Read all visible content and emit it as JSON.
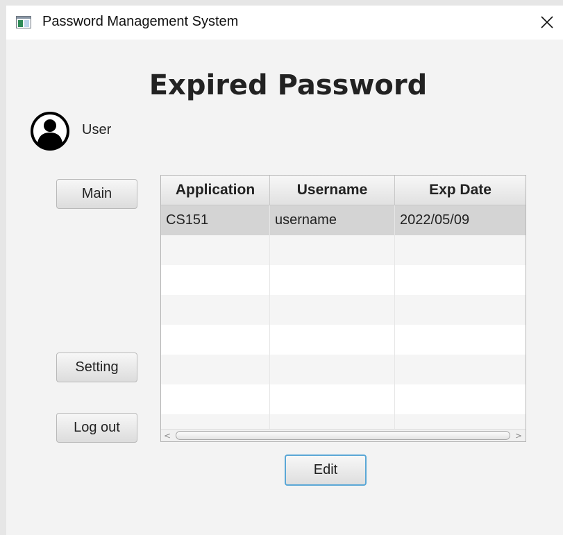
{
  "window": {
    "title": "Password Management System",
    "close_glyph": "✕"
  },
  "page": {
    "title": "Expired Password"
  },
  "user": {
    "icon": "user-circle-icon",
    "label": "User"
  },
  "sidebar": {
    "main_label": "Main",
    "setting_label": "Setting",
    "logout_label": "Log out"
  },
  "table": {
    "headers": [
      "Application",
      "Username",
      "Exp Date"
    ],
    "rows": [
      [
        "CS151",
        "username",
        "2022/05/09"
      ]
    ],
    "selected_row": 0,
    "empty_rows": 6
  },
  "scrollbar": {
    "left_glyph": "<",
    "right_glyph": ">"
  },
  "actions": {
    "edit_label": "Edit"
  },
  "colors": {
    "window_bg": "#f3f3f3",
    "titlebar_bg": "#ffffff",
    "selected_row": "#d4d4d4",
    "focus_border": "#5aa7d6"
  }
}
